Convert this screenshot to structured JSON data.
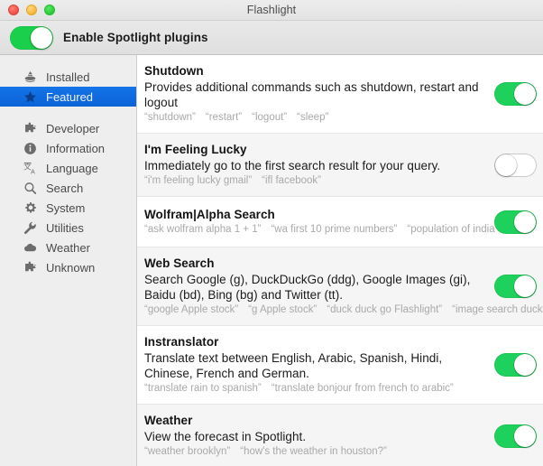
{
  "window": {
    "title": "Flashlight",
    "traffic_lights": [
      "close",
      "minimize",
      "zoom"
    ]
  },
  "toolbar": {
    "master_toggle_label": "Enable Spotlight plugins",
    "master_toggle_on": true
  },
  "sidebar": {
    "groups": [
      {
        "items": [
          {
            "label": "Installed",
            "icon": "install-arrow-icon",
            "selected": false
          },
          {
            "label": "Featured",
            "icon": "star-icon",
            "selected": true
          }
        ]
      },
      {
        "items": [
          {
            "label": "Developer",
            "icon": "puzzle-piece-icon",
            "selected": false
          },
          {
            "label": "Information",
            "icon": "info-circle-icon",
            "selected": false
          },
          {
            "label": "Language",
            "icon": "translate-icon",
            "selected": false
          },
          {
            "label": "Search",
            "icon": "magnifier-icon",
            "selected": false
          },
          {
            "label": "System",
            "icon": "gear-icon",
            "selected": false
          },
          {
            "label": "Utilities",
            "icon": "wrench-icon",
            "selected": false
          },
          {
            "label": "Weather",
            "icon": "cloud-icon",
            "selected": false
          },
          {
            "label": "Unknown",
            "icon": "puzzle-piece-icon",
            "selected": false
          }
        ]
      }
    ]
  },
  "plugins": [
    {
      "name": "Shutdown",
      "description": "Provides additional commands such as shutdown, restart and logout",
      "keywords": [
        "“shutdown”",
        "“restart”",
        "“logout”",
        "“sleep”"
      ],
      "enabled": true
    },
    {
      "name": "I'm Feeling Lucky",
      "description": "Immediately go to the first search result for your query.",
      "keywords": [
        "“i'm feeling lucky gmail”",
        "“ifl facebook”"
      ],
      "enabled": false
    },
    {
      "name": "Wolfram|Alpha Search",
      "description": "",
      "keywords": [
        "“ask wolfram alpha 1 + 1”",
        "“wa first 10 prime numbers”",
        "“population of india”"
      ],
      "enabled": true
    },
    {
      "name": "Web Search",
      "description": "Search Google (g), DuckDuckGo (ddg), Google Images (gi), Baidu (bd), Bing (bg) and Twitter (tt).",
      "keywords": [
        "“google Apple stock”",
        "“g Apple stock”",
        "“duck duck go Flashlight”",
        "“image search ducks”"
      ],
      "enabled": true
    },
    {
      "name": "Instranslator",
      "description": "Translate text between English, Arabic, Spanish, Hindi, Chinese, French and German.",
      "keywords": [
        "“translate rain to spanish”",
        "“translate bonjour from french to arabic”"
      ],
      "enabled": true
    },
    {
      "name": "Weather",
      "description": "View the forecast in Spotlight.",
      "keywords": [
        "“weather brooklyn”",
        "“how's the weather in houston?”"
      ],
      "enabled": true
    }
  ],
  "colors": {
    "toggle_on": "#1ed15c",
    "selection_blue": "#0b63d6",
    "keyword_gray": "#a9a9a9",
    "alt_row": "#f5f5f5"
  }
}
